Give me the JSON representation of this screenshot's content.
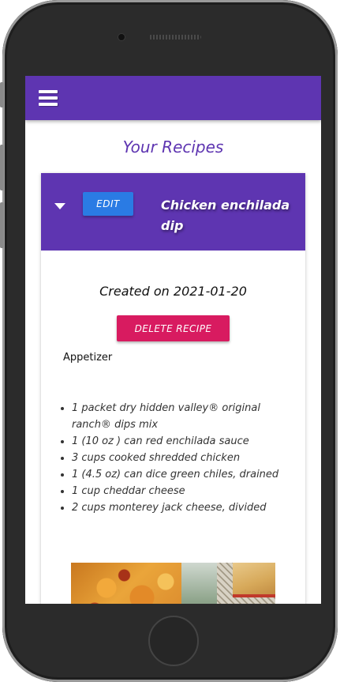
{
  "app": {
    "page_title": "Your Recipes"
  },
  "appbar": {
    "menu_icon": "hamburger-menu-icon"
  },
  "recipe": {
    "title": "Chicken enchilada dip",
    "edit_label": "EDIT",
    "created_text": "Created on 2021-01-20",
    "delete_label": "DELETE RECIPE",
    "category": "Appetizer",
    "ingredients": [
      "1 packet dry hidden valley® original ranch® dips mix",
      "1 (10 oz ) can red enchilada sauce",
      "3 cups cooked shredded chicken",
      "1 (4.5 oz) can dice green chiles, drained",
      "1 cup cheddar cheese",
      "2 cups monterey jack cheese, divided"
    ]
  },
  "colors": {
    "primary": "#5e35b1",
    "edit_button": "#2a7be4",
    "delete_button": "#d81b60"
  }
}
